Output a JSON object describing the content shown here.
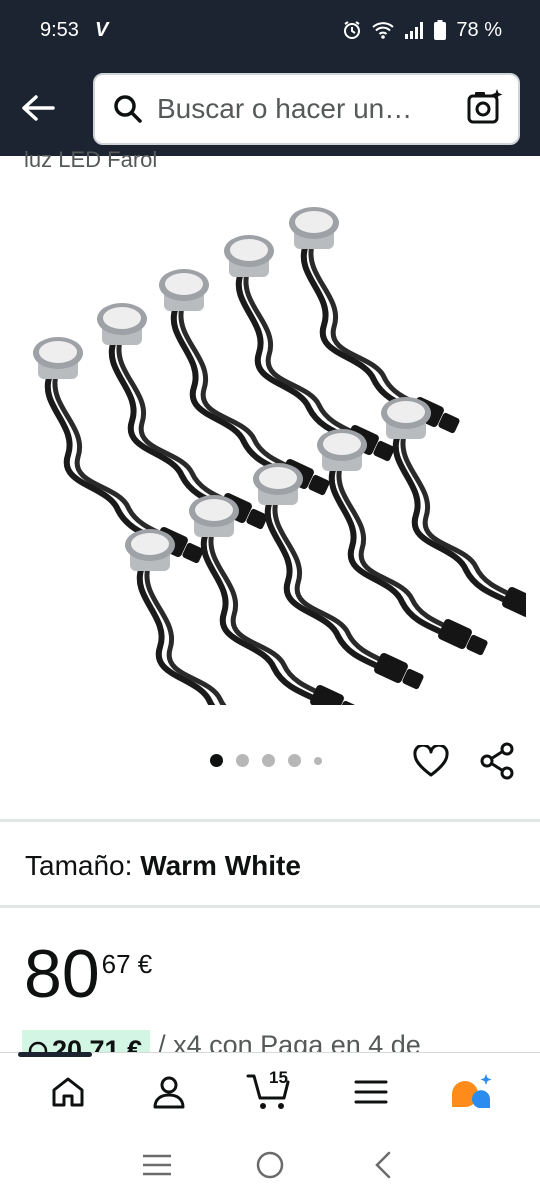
{
  "status_bar": {
    "time": "9:53",
    "carrier_glyph": "V",
    "battery": "78 %"
  },
  "search": {
    "placeholder": "Buscar o hacer un…"
  },
  "product": {
    "title_fragment": "luz LED Farol",
    "carousel": {
      "total_images": 5,
      "active_index": 0
    },
    "size_label": "Tamaño:",
    "size_value": "Warm White",
    "price_whole": "80",
    "price_fraction": "67 €",
    "installment_amount": "20,71 €",
    "installment_text": "/ x4 con Paga en 4 de"
  },
  "bottom_nav": {
    "items": [
      "home-icon",
      "account-icon",
      "cart-icon",
      "menu-icon",
      "rufus-ai-icon"
    ],
    "cart_count": "15"
  },
  "colors": {
    "header_bg": "#1b2430",
    "rufus_orange": "#ff8c1a",
    "rufus_blue": "#2b8cf0",
    "installment_badge": "#d3f5e3"
  }
}
